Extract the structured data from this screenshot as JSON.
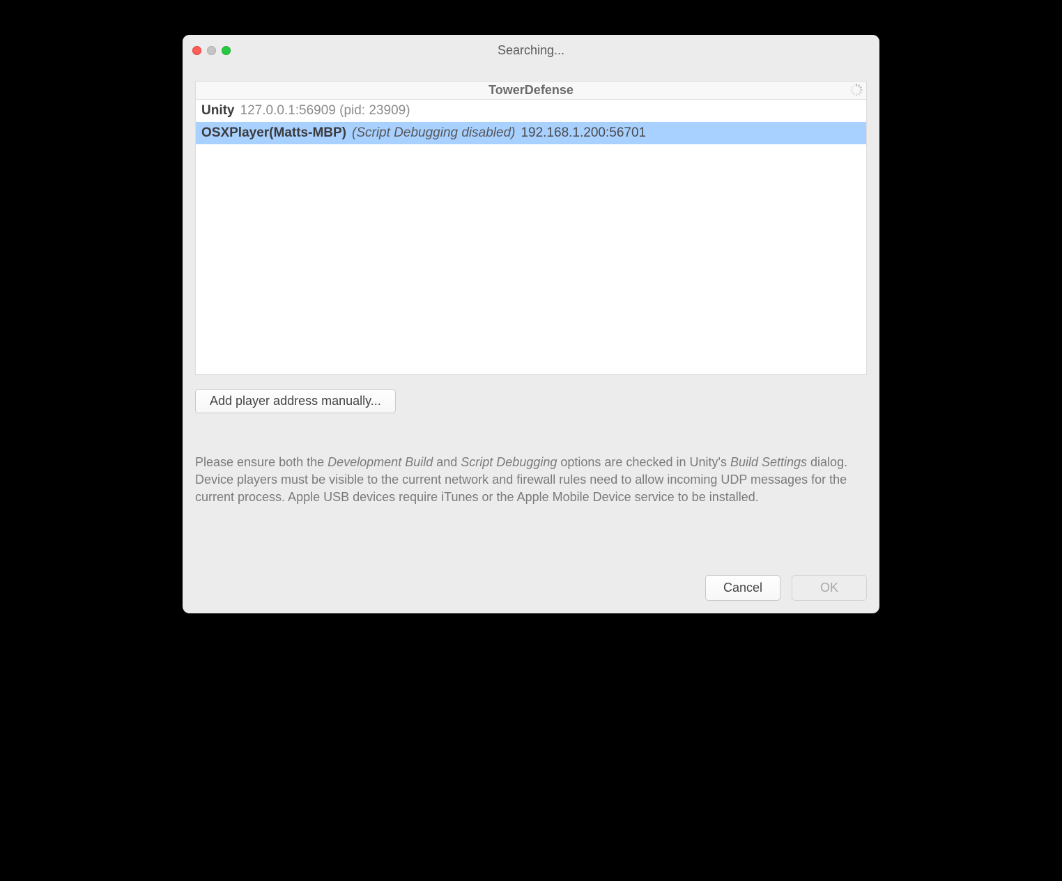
{
  "window": {
    "title": "Searching..."
  },
  "group": {
    "title": "TowerDefense"
  },
  "players": [
    {
      "name": "Unity",
      "note": "",
      "address": "127.0.0.1:56909 (pid: 23909)",
      "selected": false
    },
    {
      "name": "OSXPlayer(Matts-MBP)",
      "note": "(Script Debugging disabled)",
      "address": "192.168.1.200:56701",
      "selected": true
    }
  ],
  "buttons": {
    "add_manual": "Add player address manually...",
    "cancel": "Cancel",
    "ok": "OK"
  },
  "help": {
    "p1a": "Please ensure both the ",
    "i1": "Development Build",
    "p1b": "  and ",
    "i2": "Script Debugging",
    "p1c": "  options are checked in Unity's ",
    "i3": "Build Settings",
    "p1d": " dialog. Device players must be visible to the current network and firewall rules need to allow incoming UDP messages for the current process. Apple USB devices require iTunes or the Apple Mobile Device service to be installed."
  }
}
